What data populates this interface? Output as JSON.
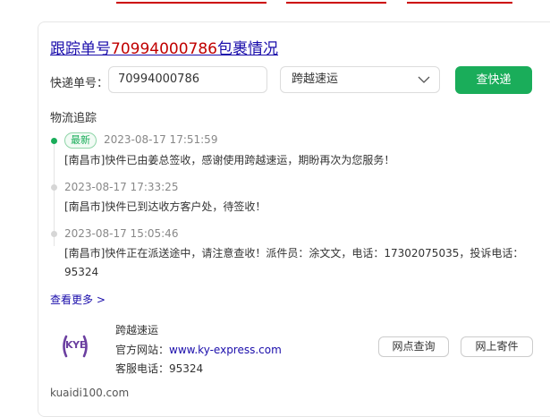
{
  "header": {
    "title_prefix": "跟踪单号",
    "tracking_number": "70994000786",
    "title_suffix": "包裹情况"
  },
  "form": {
    "number_label": "快递单号：",
    "number_value": "70994000786",
    "company_selected": "跨越速运",
    "query_button": "查快递"
  },
  "tracking": {
    "section_label": "物流追踪",
    "latest_badge": "最新",
    "events": [
      {
        "time": "2023-08-17 17:51:59",
        "text": "[南昌市]快件已由姜总签收，感谢使用跨越速运，期盼再次为您服务！"
      },
      {
        "time": "2023-08-17 17:33:25",
        "text": "[南昌市]快件已到达收方客户处，待签收！"
      },
      {
        "time": "2023-08-17 15:05:46",
        "text": "[南昌市]快件正在派送途中，请注意查收！派件员：涂文文，电话：17302075035，投诉电话：95324"
      }
    ],
    "more_link": "查看更多 >"
  },
  "company": {
    "logo_text": "KYE",
    "name": "跨越速运",
    "site_label": "官方网站：",
    "site_url": "www.ky-express.com",
    "phone_label": "客服电话：",
    "phone": "95324",
    "btn_site_query": "网点查询",
    "btn_online_ship": "网上寄件"
  },
  "footer": {
    "domain": "kuaidi100.com"
  },
  "colors": {
    "accent_green": "#1aad5a",
    "link_blue": "#1a0dab",
    "number_red": "#c00000",
    "logo_purple": "#6b3fa0"
  }
}
